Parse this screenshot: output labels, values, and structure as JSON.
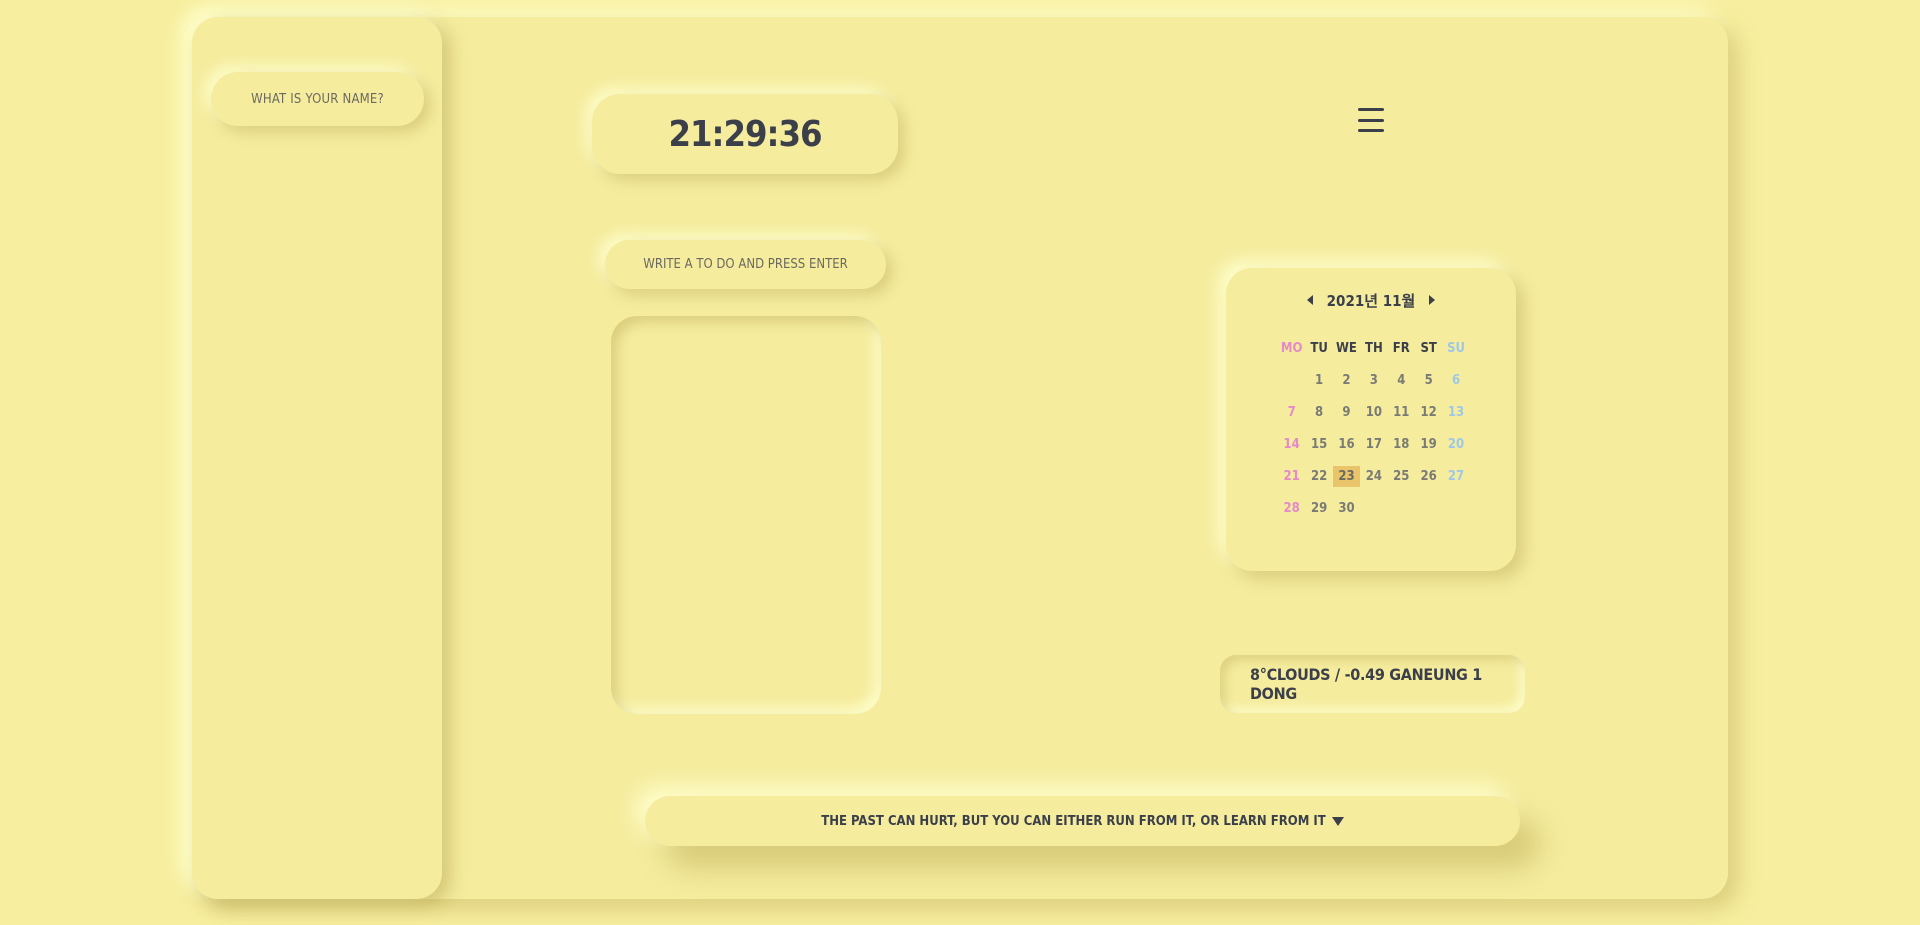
{
  "name_prompt": "WHAT IS YOUR NAME?",
  "clock": "21:29:36",
  "todo_placeholder": "WRITE A TO DO AND PRESS ENTER",
  "calendar": {
    "title": "2021년 11월",
    "weekdays": [
      "MO",
      "TU",
      "WE",
      "TH",
      "FR",
      "ST",
      "SU"
    ],
    "weeks": [
      [
        "",
        "1",
        "2",
        "3",
        "4",
        "5",
        "6"
      ],
      [
        "7",
        "8",
        "9",
        "10",
        "11",
        "12",
        "13"
      ],
      [
        "14",
        "15",
        "16",
        "17",
        "18",
        "19",
        "20"
      ],
      [
        "21",
        "22",
        "23",
        "24",
        "25",
        "26",
        "27"
      ],
      [
        "28",
        "29",
        "30",
        "",
        "",
        "",
        ""
      ]
    ],
    "today": "23"
  },
  "weather": "8°CLOUDS / -0.49 GANEUNG 1 DONG",
  "quote": "THE PAST CAN HURT, BUT YOU CAN EITHER RUN FROM IT, OR LEARN FROM IT",
  "colors": {
    "background": "#f7ee9f",
    "text": "#3b3f4a",
    "monday": "#e58ac9",
    "sunday": "#9fc8e6",
    "today_highlight": "#e9c46b"
  }
}
